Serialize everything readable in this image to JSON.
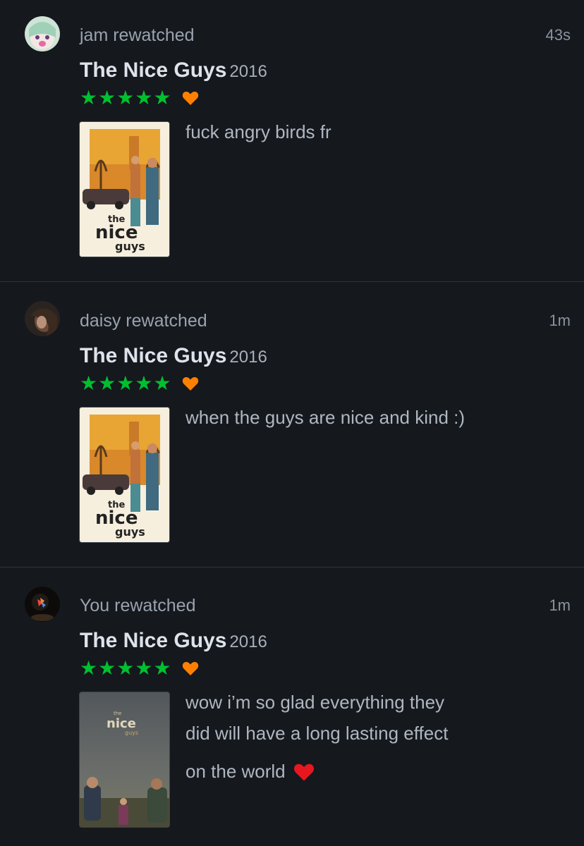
{
  "feed": [
    {
      "user_action": "jam rewatched",
      "time": "43s",
      "film_title": "The Nice Guys",
      "film_year": "2016",
      "rating_stars": 5,
      "liked": true,
      "poster": "the-nice-guys-poster-art",
      "poster_text_top": "the",
      "poster_text_mid": "nice",
      "poster_text_bot": "guys",
      "review_lines": [
        "fuck angry birds fr"
      ]
    },
    {
      "user_action": "daisy rewatched",
      "time": "1m",
      "film_title": "The Nice Guys",
      "film_year": "2016",
      "rating_stars": 5,
      "liked": true,
      "poster": "the-nice-guys-poster-art",
      "poster_text_top": "the",
      "poster_text_mid": "nice",
      "poster_text_bot": "guys",
      "review_lines": [
        "when the guys are nice and kind :)"
      ]
    },
    {
      "user_action": "You rewatched",
      "time": "1m",
      "film_title": "The Nice Guys",
      "film_year": "2016",
      "rating_stars": 5,
      "liked": true,
      "poster": "the-nice-guys-poster-photo",
      "poster_text_top": "the",
      "poster_text_mid": "nice",
      "poster_text_bot": "guys",
      "review_lines": [
        "wow i’m so glad everything they",
        "did will have a long lasting effect",
        "on the world"
      ],
      "review_emoji": "red-heart-emoji"
    }
  ],
  "colors": {
    "background": "#15181d",
    "star_green": "#00c030",
    "heart_orange": "#ff8000",
    "separator": "#2c3440"
  }
}
